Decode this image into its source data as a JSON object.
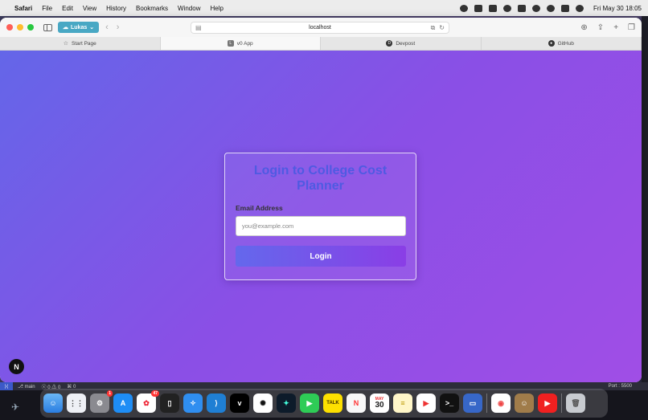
{
  "menubar": {
    "app_name": "Safari",
    "items": [
      "File",
      "Edit",
      "View",
      "History",
      "Bookmarks",
      "Window",
      "Help"
    ],
    "clock": "Fri May 30  18:05"
  },
  "browser": {
    "profile": "Lukas",
    "url": "localhost",
    "tabs": [
      {
        "label": "Start Page",
        "icon": "star-icon"
      },
      {
        "label": "v0 App",
        "icon": "app-icon"
      },
      {
        "label": "Devpost",
        "icon": "devpost-icon"
      },
      {
        "label": "GitHub",
        "icon": "github-icon"
      }
    ]
  },
  "login": {
    "title": "Login to College Cost Planner",
    "email_label": "Email Address",
    "email_placeholder": "you@example.com",
    "email_value": "",
    "button_label": "Login"
  },
  "statusbar": {
    "branch": "main",
    "problems": "0 ⚠ 0",
    "ports": "0",
    "port": "Port : 5500"
  },
  "dock": {
    "apps": [
      "Finder",
      "Launchpad",
      "System Settings",
      "App Store",
      "Calendar",
      "iPhone Mirroring",
      "Safari",
      "VS Code",
      "v0",
      "ChatGPT",
      "Cursor",
      "FaceTime",
      "KakaoTalk",
      "News",
      "Calendar Date",
      "Notes",
      "Music",
      "Terminal",
      "Remote",
      "Chrome",
      "Contacts",
      "YouTube",
      "Trash"
    ],
    "calendar_month": "MAY",
    "calendar_day": "30",
    "settings_badge": "1",
    "calendar_badge": "47"
  },
  "colors": {
    "page_gradient_start": "#6466e8",
    "page_gradient_end": "#a04ee6",
    "title_color": "#4f5ae2"
  }
}
